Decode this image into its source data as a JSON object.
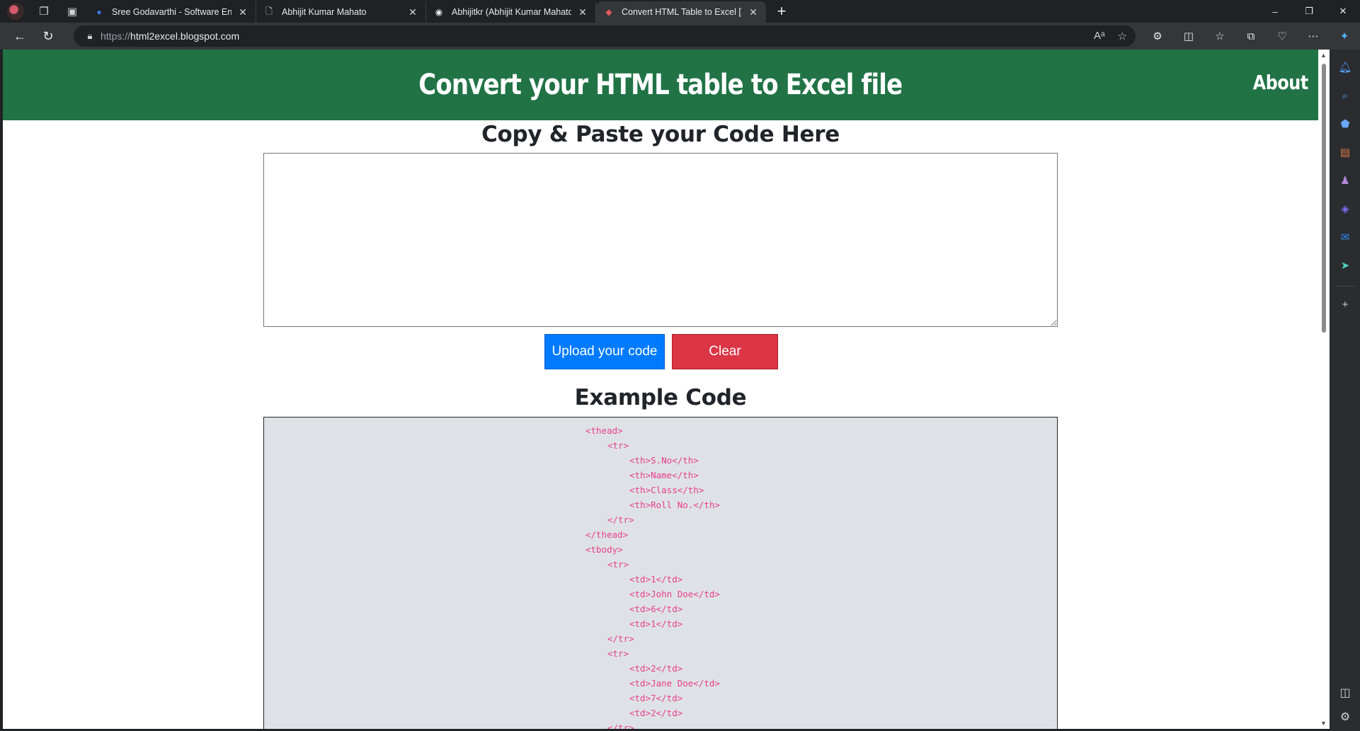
{
  "browser": {
    "tabs": [
      {
        "title": "Sree Godavarthi - Software Engi",
        "icon": "circle-blue-icon"
      },
      {
        "title": "Abhijit Kumar Mahato",
        "icon": "page-icon"
      },
      {
        "title": "Abhijitkr (Abhijit Kumar Mahato)",
        "icon": "github-icon"
      },
      {
        "title": "Convert HTML Table to Excel [Xls",
        "icon": "site-icon",
        "active": true
      }
    ],
    "url_protocol": "https://",
    "url_host": "html2excel.blogspot.com"
  },
  "page": {
    "header_title": "Convert your HTML table to Excel file",
    "about_label": "About",
    "paste_heading": "Copy & Paste your Code Here",
    "upload_label": "Upload your code",
    "clear_label": "Clear",
    "example_heading": "Example Code",
    "example_lines": [
      {
        "indent": 0,
        "text": "<thead>"
      },
      {
        "indent": 1,
        "text": "<tr>"
      },
      {
        "indent": 2,
        "text": "<th>S.No</th>"
      },
      {
        "indent": 2,
        "text": "<th>Name</th>"
      },
      {
        "indent": 2,
        "text": "<th>Class</th>"
      },
      {
        "indent": 2,
        "text": "<th>Roll No.</th>"
      },
      {
        "indent": 1,
        "text": "</tr>"
      },
      {
        "indent": 0,
        "text": "</thead>"
      },
      {
        "indent": 0,
        "text": "<tbody>"
      },
      {
        "indent": 1,
        "text": "<tr>"
      },
      {
        "indent": 2,
        "text": "<td>1</td>"
      },
      {
        "indent": 2,
        "text": "<td>John Doe</td>"
      },
      {
        "indent": 2,
        "text": "<td>6</td>"
      },
      {
        "indent": 2,
        "text": "<td>1</td>"
      },
      {
        "indent": 1,
        "text": "</tr>"
      },
      {
        "indent": 1,
        "text": "<tr>"
      },
      {
        "indent": 2,
        "text": "<td>2</td>"
      },
      {
        "indent": 2,
        "text": "<td>Jane Doe</td>"
      },
      {
        "indent": 2,
        "text": "<td>7</td>"
      },
      {
        "indent": 2,
        "text": "<td>2</td>"
      },
      {
        "indent": 1,
        "text": "</tr>"
      }
    ]
  },
  "colors": {
    "header_green": "#217346",
    "upload_blue": "#007bff",
    "clear_red": "#dc3545",
    "code_pink": "#e83e8c"
  }
}
